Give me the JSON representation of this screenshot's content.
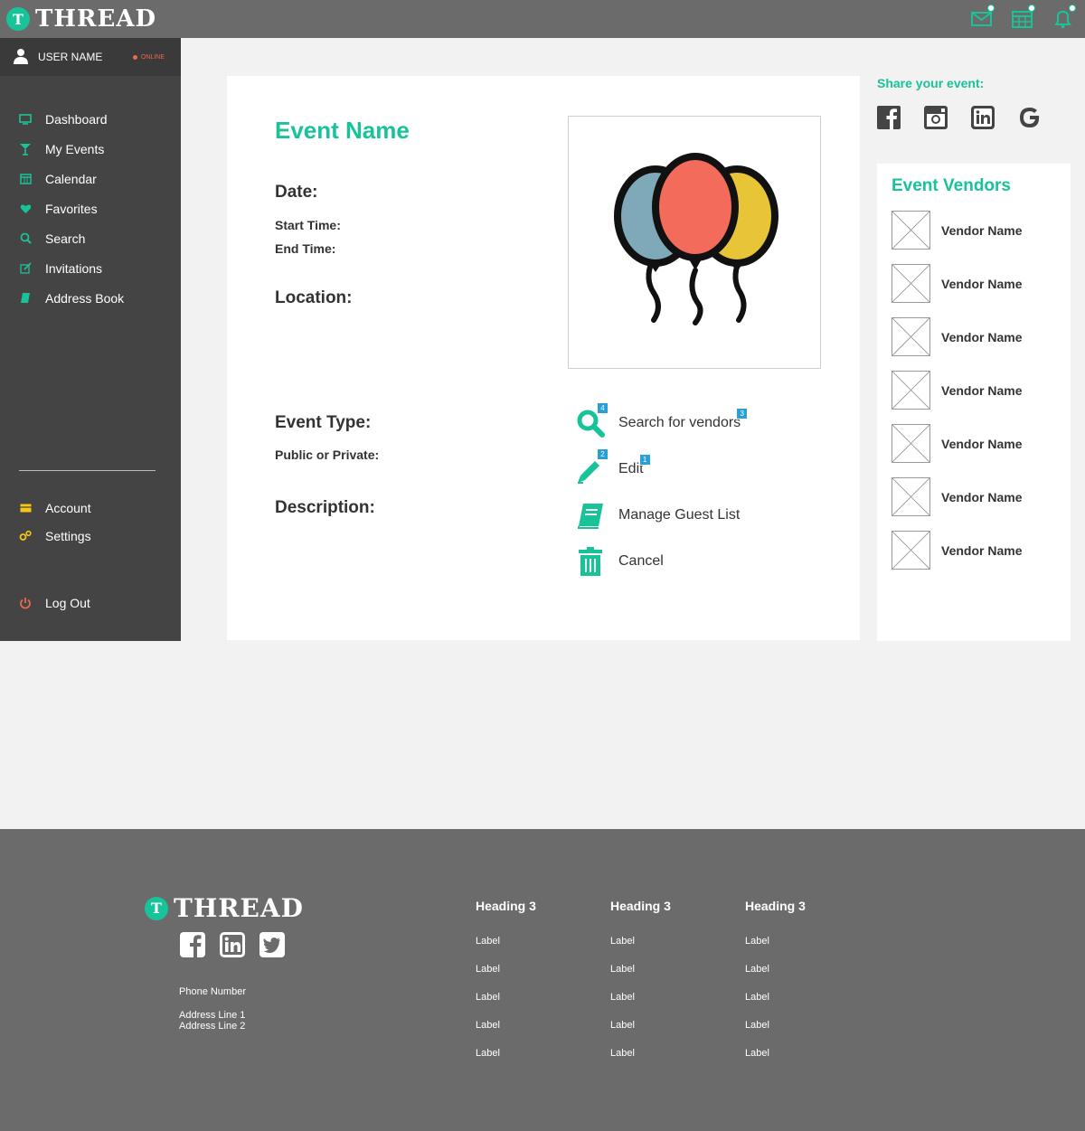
{
  "app": {
    "logo_letter": "T",
    "logo_word": "THREAD"
  },
  "topbar": {
    "icons": [
      "mail-icon",
      "calendar-icon",
      "bell-icon"
    ]
  },
  "user": {
    "name": "USER NAME",
    "status": "ONLINE"
  },
  "sidebar": {
    "items": [
      {
        "label": "Dashboard",
        "icon": "monitor-icon"
      },
      {
        "label": "My Events",
        "icon": "cocktail-icon"
      },
      {
        "label": "Calendar",
        "icon": "calendar-icon"
      },
      {
        "label": "Favorites",
        "icon": "heart-icon"
      },
      {
        "label": "Search",
        "icon": "search-icon"
      },
      {
        "label": "Invitations",
        "icon": "edit-icon"
      },
      {
        "label": "Address Book",
        "icon": "book-icon"
      }
    ],
    "secondary": [
      {
        "label": "Account",
        "icon": "card-icon"
      },
      {
        "label": "Settings",
        "icon": "gears-icon"
      }
    ],
    "logout": {
      "label": "Log Out",
      "icon": "power-icon"
    }
  },
  "event": {
    "name": "Event Name",
    "date_label": "Date:",
    "start_label": "Start Time:",
    "end_label": "End Time:",
    "location_label": "Location:",
    "type_label": "Event Type:",
    "privacy_label": "Public or Private:",
    "description_label": "Description:",
    "image_icon": "balloons-icon"
  },
  "actions": [
    {
      "label": "Search for vendors",
      "icon": "search-icon",
      "icon_badge": "4",
      "text_badge": "3"
    },
    {
      "label": "Edit",
      "icon": "pencil-icon",
      "icon_badge": "2",
      "text_badge": "1"
    },
    {
      "label": "Manage Guest List",
      "icon": "book-icon"
    },
    {
      "label": "Cancel",
      "icon": "trash-icon"
    }
  ],
  "share": {
    "title": "Share your event:",
    "icons": [
      "facebook-icon",
      "instagram-icon",
      "linkedin-icon",
      "google-icon"
    ]
  },
  "vendors": {
    "title": "Event Vendors",
    "items": [
      "Vendor Name",
      "Vendor Name",
      "Vendor Name",
      "Vendor Name",
      "Vendor Name",
      "Vendor Name",
      "Vendor Name"
    ]
  },
  "footer": {
    "phone": "Phone Number",
    "address1": "Address Line 1",
    "address2": "Address Line 2",
    "social": [
      "facebook-icon",
      "linkedin-icon",
      "twitter-icon"
    ],
    "columns": [
      {
        "heading": "Heading 3",
        "labels": [
          "Label",
          "Label",
          "Label",
          "Label",
          "Label"
        ]
      },
      {
        "heading": "Heading 3",
        "labels": [
          "Label",
          "Label",
          "Label",
          "Label",
          "Label"
        ]
      },
      {
        "heading": "Heading 3",
        "labels": [
          "Label",
          "Label",
          "Label",
          "Label",
          "Label"
        ]
      }
    ]
  },
  "colors": {
    "accent": "#19c39a",
    "sidebar": "#444444",
    "topbar": "#6b6b6b",
    "alert": "#e86a4f",
    "badge": "#2a9fd6",
    "yellow": "#f5c518"
  }
}
